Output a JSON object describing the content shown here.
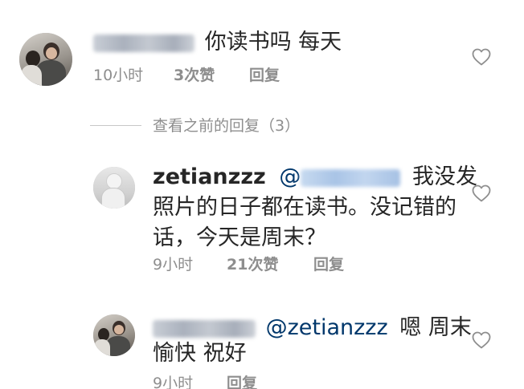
{
  "comment_1": {
    "text": "你读书吗 每天",
    "time": "10小时",
    "likes": "3次赞",
    "reply": "回复"
  },
  "view_previous": {
    "label": "查看之前的回复（3）"
  },
  "reply_1": {
    "username": "zetianzzz",
    "mention_prefix": "@",
    "line1": "我没发",
    "line2": "照片的日子都在读书。没记错的",
    "line3": "话，今天是周末？",
    "time": "9小时",
    "likes": "21次赞",
    "reply": "回复"
  },
  "reply_2": {
    "mention": "@zetianzzz",
    "line1_tail": "嗯 周末",
    "line2": "愉快 祝好",
    "time": "9小时",
    "reply": "回复"
  },
  "colors": {
    "primary_text": "#262626",
    "secondary_text": "#8e8e8e",
    "mention": "#00376b"
  },
  "icons": [
    "avatar",
    "heart-icon"
  ]
}
